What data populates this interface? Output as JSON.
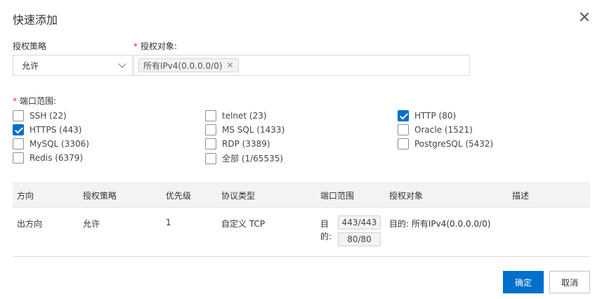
{
  "dialog": {
    "title": "快速添加",
    "close_icon": "close-icon"
  },
  "policy": {
    "label": "授权策略",
    "value": "允许",
    "dropdown_icon": "chevron-down-icon"
  },
  "target": {
    "label": "授权对象:",
    "tags": [
      {
        "label": "所有IPv4(0.0.0.0/0)",
        "remove_icon": "close-icon"
      }
    ]
  },
  "ports": {
    "label": "端口范围:",
    "options": [
      {
        "label": "SSH (22)",
        "checked": false
      },
      {
        "label": "telnet (23)",
        "checked": false
      },
      {
        "label": "HTTP (80)",
        "checked": true
      },
      {
        "label": "HTTPS (443)",
        "checked": true
      },
      {
        "label": "MS SQL (1433)",
        "checked": false
      },
      {
        "label": "Oracle (1521)",
        "checked": false
      },
      {
        "label": "MySQL (3306)",
        "checked": false
      },
      {
        "label": "RDP (3389)",
        "checked": false
      },
      {
        "label": "PostgreSQL (5432)",
        "checked": false
      },
      {
        "label": "Redis (6379)",
        "checked": false
      },
      {
        "label": "全部 (1/65535)",
        "checked": false
      }
    ]
  },
  "table": {
    "headers": [
      "方向",
      "授权策略",
      "优先级",
      "协议类型",
      "端口范围",
      "授权对象",
      "描述"
    ],
    "rows": [
      {
        "direction": "出方向",
        "policy": "允许",
        "priority": "1",
        "protocol": "自定义 TCP",
        "port_prefix_1": "目",
        "port_prefix_2": "的:",
        "ports": [
          "443/443",
          "80/80"
        ],
        "target": "目的: 所有IPv4(0.0.0.0/0)",
        "description": ""
      }
    ]
  },
  "footer": {
    "confirm": "确定",
    "cancel": "取消"
  },
  "colors": {
    "primary": "#0070cc",
    "required": "#e0301e",
    "header_bg": "#f2f3f5"
  }
}
